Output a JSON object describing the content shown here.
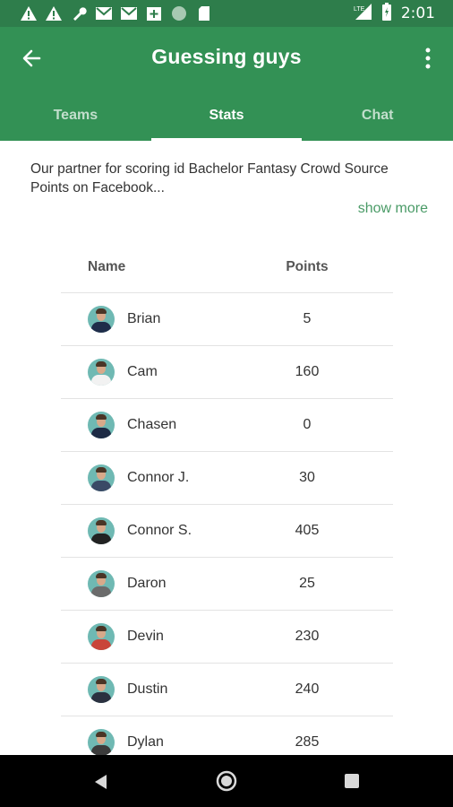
{
  "status_bar": {
    "time": "2:01",
    "icons": [
      "warning-icon",
      "warning-icon",
      "wrench-icon",
      "gmail-icon",
      "gmail-icon",
      "calendar-plus-icon",
      "dot-icon",
      "sd-card-icon"
    ],
    "network": "LTE"
  },
  "app_bar": {
    "title": "Guessing guys"
  },
  "tabs": [
    {
      "label": "Teams",
      "active": false
    },
    {
      "label": "Stats",
      "active": true
    },
    {
      "label": "Chat",
      "active": false
    }
  ],
  "description": {
    "text": "Our partner for scoring id Bachelor Fantasy Crowd Source Points on Facebook...",
    "show_more": "show more"
  },
  "table": {
    "headers": {
      "name": "Name",
      "points": "Points"
    },
    "rows": [
      {
        "name": "Brian",
        "points": "5",
        "shirt": "#1f2d4a"
      },
      {
        "name": "Cam",
        "points": "160",
        "shirt": "#f2f2f2"
      },
      {
        "name": "Chasen",
        "points": "0",
        "shirt": "#1d2a44"
      },
      {
        "name": "Connor J.",
        "points": "30",
        "shirt": "#3a4a66"
      },
      {
        "name": "Connor S.",
        "points": "405",
        "shirt": "#222222"
      },
      {
        "name": "Daron",
        "points": "25",
        "shirt": "#6b6b6b"
      },
      {
        "name": "Devin",
        "points": "230",
        "shirt": "#c9453a"
      },
      {
        "name": "Dustin",
        "points": "240",
        "shirt": "#2b3140"
      },
      {
        "name": "Dylan",
        "points": "285",
        "shirt": "#3b3b3b"
      }
    ]
  },
  "colors": {
    "status_bar": "#2e7d4b",
    "app_bar": "#339155",
    "accent_link": "#4a9b67"
  }
}
